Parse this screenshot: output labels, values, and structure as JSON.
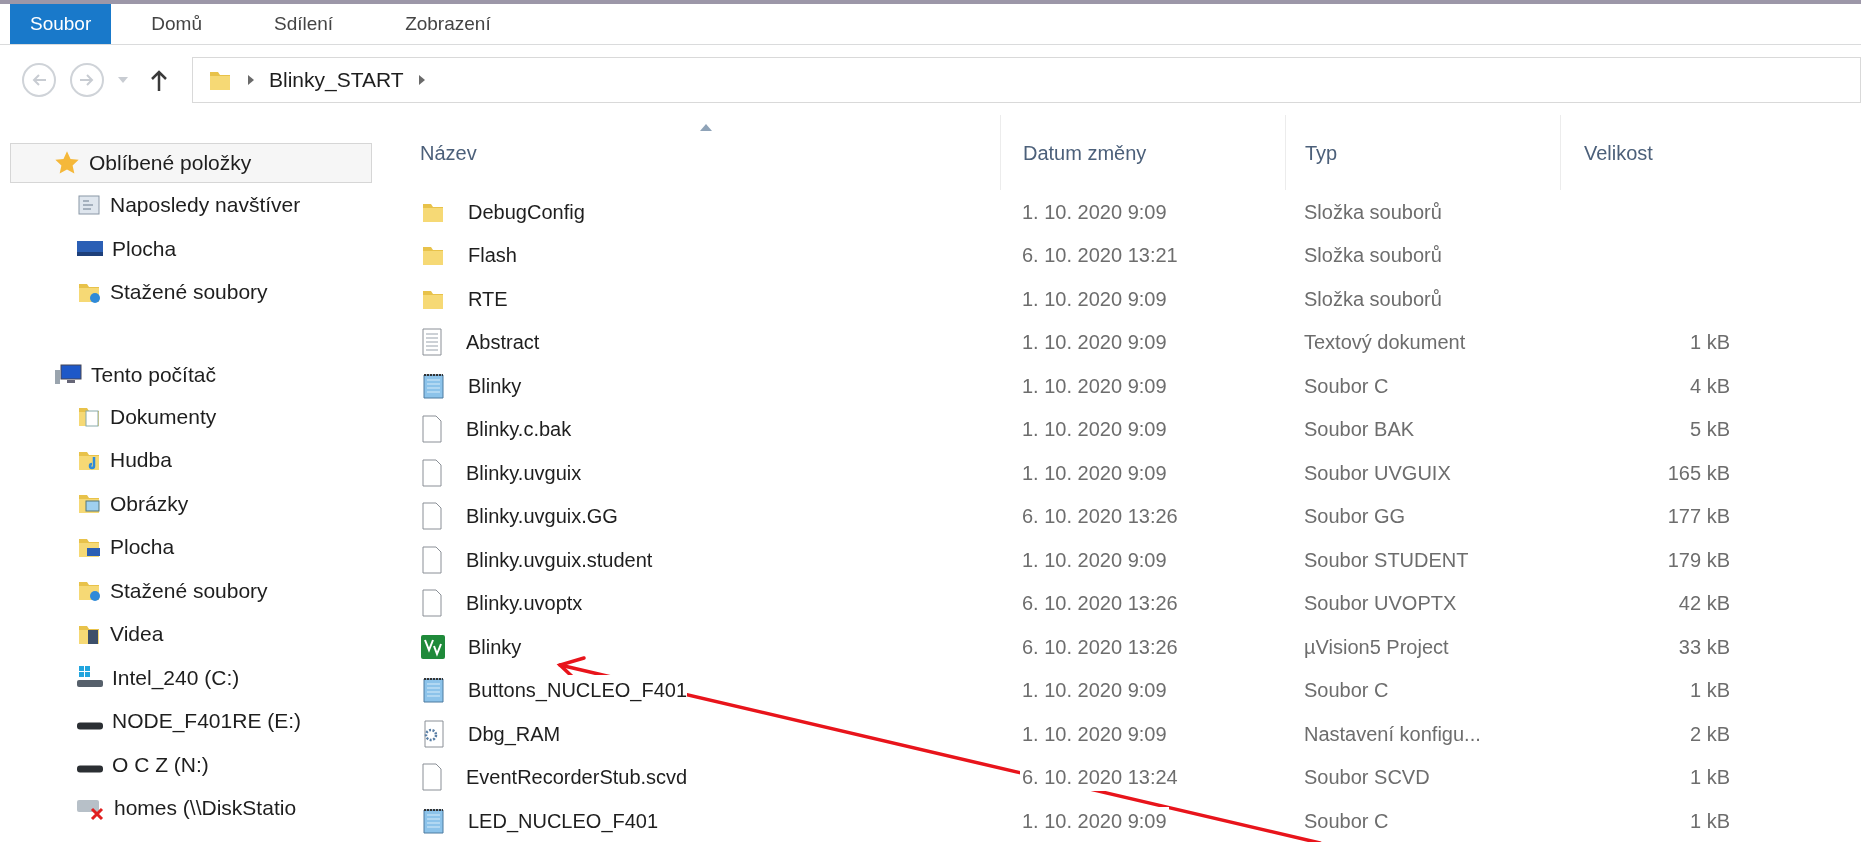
{
  "ribbon_tabs": [
    {
      "label": "Soubor",
      "selected": true
    },
    {
      "label": "Domů",
      "selected": false
    },
    {
      "label": "Sdílení",
      "selected": false
    },
    {
      "label": "Zobrazení",
      "selected": false
    }
  ],
  "address_bar": {
    "path": [
      "Blinky_START"
    ]
  },
  "sidebar": {
    "groups": [
      {
        "label": "Oblíbené položky",
        "kind": "star",
        "selected": true,
        "children": [
          {
            "label": "Naposledy navštíver",
            "kind": "recent"
          },
          {
            "label": "Plocha",
            "kind": "desktop"
          },
          {
            "label": "Stažené soubory",
            "kind": "downloads"
          }
        ]
      },
      {
        "label": "Tento počítač",
        "kind": "computer",
        "selected": false,
        "children": [
          {
            "label": "Dokumenty",
            "kind": "documents"
          },
          {
            "label": "Hudba",
            "kind": "music"
          },
          {
            "label": "Obrázky",
            "kind": "pictures"
          },
          {
            "label": "Plocha",
            "kind": "desktop-folder"
          },
          {
            "label": "Stažené soubory",
            "kind": "downloads"
          },
          {
            "label": "Videa",
            "kind": "videos"
          },
          {
            "label": "Intel_240 (C:)",
            "kind": "system-drive"
          },
          {
            "label": "NODE_F401RE (E:)",
            "kind": "drive"
          },
          {
            "label": "O C Z (N:)",
            "kind": "drive"
          },
          {
            "label": "homes (\\\\DiskStatio",
            "kind": "network-off"
          }
        ]
      }
    ]
  },
  "table": {
    "columns": [
      {
        "label": "Název",
        "sorted": true
      },
      {
        "label": "Datum změny",
        "sorted": false
      },
      {
        "label": "Typ",
        "sorted": false
      },
      {
        "label": "Velikost",
        "sorted": false
      }
    ],
    "rows": [
      {
        "name": "DebugConfig",
        "kind": "folder",
        "date": "1. 10. 2020 9:09",
        "type": "Složka souborů"
      },
      {
        "name": "Flash",
        "kind": "folder",
        "date": "6. 10. 2020 13:21",
        "type": "Složka souborů"
      },
      {
        "name": "RTE",
        "kind": "folder",
        "date": "1. 10. 2020 9:09",
        "type": "Složka souborů"
      },
      {
        "name": "Abstract",
        "kind": "text",
        "date": "1. 10. 2020 9:09",
        "type": "Textový dokument",
        "size": "1 kB"
      },
      {
        "name": "Blinky",
        "kind": "c-source",
        "date": "1. 10. 2020 9:09",
        "type": "Soubor C",
        "size": "4 kB"
      },
      {
        "name": "Blinky.c.bak",
        "kind": "file",
        "date": "1. 10. 2020 9:09",
        "type": "Soubor BAK",
        "size": "5 kB"
      },
      {
        "name": "Blinky.uvguix",
        "kind": "file",
        "date": "1. 10. 2020 9:09",
        "type": "Soubor UVGUIX",
        "size": "165 kB"
      },
      {
        "name": "Blinky.uvguix.GG",
        "kind": "file",
        "date": "6. 10. 2020 13:26",
        "type": "Soubor GG",
        "size": "177 kB"
      },
      {
        "name": "Blinky.uvguix.student",
        "kind": "file",
        "date": "1. 10. 2020 9:09",
        "type": "Soubor STUDENT",
        "size": "179 kB"
      },
      {
        "name": "Blinky.uvoptx",
        "kind": "file",
        "date": "6. 10. 2020 13:26",
        "type": "Soubor UVOPTX",
        "size": "42 kB"
      },
      {
        "name": "Blinky",
        "kind": "project",
        "date": "6. 10. 2020 13:26",
        "type": "µVision5 Project",
        "size": "33 kB"
      },
      {
        "name": "Buttons_NUCLEO_F401",
        "kind": "c-source",
        "date": "1. 10. 2020 9:09",
        "type": "Soubor C",
        "size": "1 kB"
      },
      {
        "name": "Dbg_RAM",
        "kind": "config",
        "date": "1. 10. 2020 9:09",
        "type": "Nastavení konfigu...",
        "size": "2 kB"
      },
      {
        "name": "EventRecorderStub.scvd",
        "kind": "file",
        "date": "6. 10. 2020 13:24",
        "type": "Soubor SCVD",
        "size": "1 kB"
      },
      {
        "name": "LED_NUCLEO_F401",
        "kind": "c-source",
        "date": "1. 10. 2020 9:09",
        "type": "Soubor C",
        "size": "1 kB"
      }
    ]
  }
}
